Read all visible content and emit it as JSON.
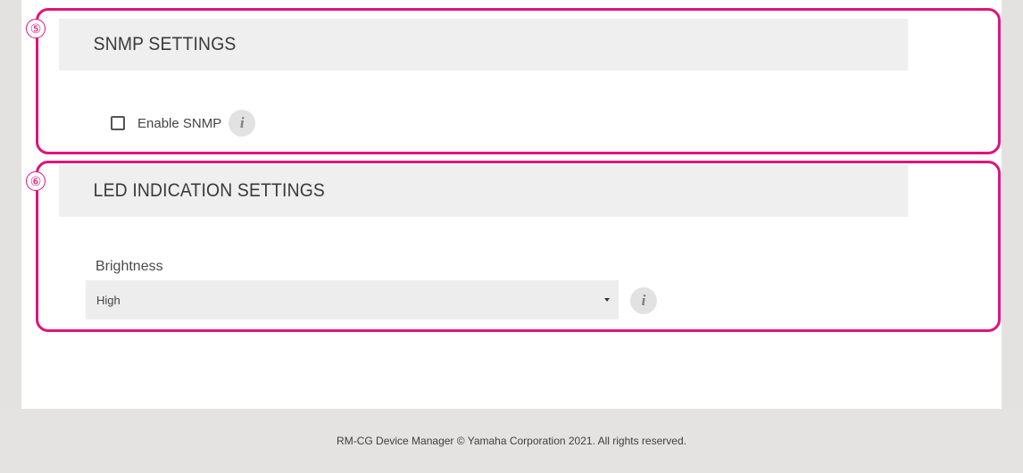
{
  "markers": {
    "snmp": "⑤",
    "led": "⑥"
  },
  "snmp": {
    "title": "SNMP SETTINGS",
    "enable_label": "Enable SNMP",
    "enabled": false,
    "info_icon": "i"
  },
  "led": {
    "title": "LED INDICATION SETTINGS",
    "brightness_label": "Brightness",
    "brightness_value": "High",
    "info_icon": "i"
  },
  "footer": {
    "text": "RM-CG Device Manager © Yamaha Corporation 2021. All rights reserved."
  },
  "colors": {
    "callout": "#e0137d",
    "page_bg": "#e3e2e0",
    "header_bg": "#efefef",
    "select_bg": "#ededed"
  },
  "icons": {
    "info": "info-icon",
    "dropdown": "caret-down-icon"
  }
}
